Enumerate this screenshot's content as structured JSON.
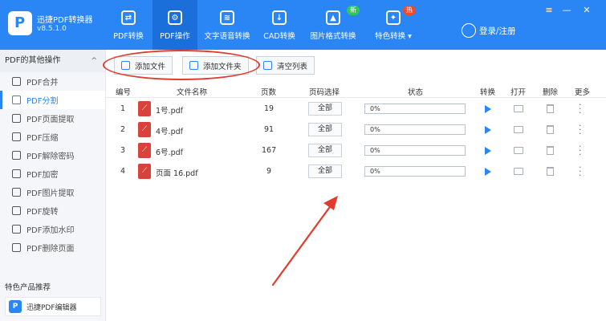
{
  "app": {
    "name": "迅捷PDF转换器",
    "version": "v8.5.1.0",
    "logo_letter": "P"
  },
  "nav": [
    {
      "label": "PDF转换",
      "icon": "refresh-icon",
      "glyph": "⇄"
    },
    {
      "label": "PDF操作",
      "icon": "gear-icon",
      "glyph": "⚙",
      "active": true
    },
    {
      "label": "文字语音转换",
      "icon": "audio-wave-icon",
      "glyph": "≋"
    },
    {
      "label": "CAD转换",
      "icon": "download-icon",
      "glyph": "↓"
    },
    {
      "label": "图片格式转换",
      "icon": "image-icon",
      "glyph": "▲",
      "badge": "新"
    },
    {
      "label": "特色转换 ▾",
      "icon": "star-gear-icon",
      "glyph": "✦",
      "badge": "热"
    }
  ],
  "login": {
    "label": "登录/注册"
  },
  "window_controls": {
    "menu": "≡",
    "minimize": "—",
    "close": "✕"
  },
  "sidebar": {
    "header": "PDF的其他操作",
    "chevron": "^",
    "items": [
      {
        "label": "PDF合并",
        "icon": "merge-icon"
      },
      {
        "label": "PDF分割",
        "icon": "split-icon",
        "active": true
      },
      {
        "label": "PDF页面提取",
        "icon": "page-extract-icon"
      },
      {
        "label": "PDF压缩",
        "icon": "compress-icon"
      },
      {
        "label": "PDF解除密码",
        "icon": "unlock-icon"
      },
      {
        "label": "PDF加密",
        "icon": "shield-icon"
      },
      {
        "label": "PDF图片提取",
        "icon": "image-extract-icon"
      },
      {
        "label": "PDF旋转",
        "icon": "rotate-icon"
      },
      {
        "label": "PDF添加水印",
        "icon": "watermark-icon"
      },
      {
        "label": "PDF删除页面",
        "icon": "delete-page-icon"
      }
    ],
    "section_title": "特色产品推荐",
    "promo": {
      "label": "迅捷PDF编辑器",
      "logo": "P"
    }
  },
  "toolbar": {
    "add_file": "添加文件",
    "add_folder": "添加文件夹",
    "clear_list": "清空列表"
  },
  "table": {
    "headers": [
      "编号",
      "文件名称",
      "页数",
      "页码选择",
      "状态",
      "转换",
      "打开",
      "删除",
      "更多"
    ],
    "page_select_label": "全部",
    "rows": [
      {
        "index": "1",
        "name": "1号.pdf",
        "pages": "19",
        "progress": "0%"
      },
      {
        "index": "2",
        "name": "4号.pdf",
        "pages": "91",
        "progress": "0%"
      },
      {
        "index": "3",
        "name": "6号.pdf",
        "pages": "167",
        "progress": "0%"
      },
      {
        "index": "4",
        "name": "页面 16.pdf",
        "pages": "9",
        "progress": "0%"
      }
    ]
  },
  "colors": {
    "primary": "#2b86f5",
    "annotation": "#e23a2e",
    "pdf_icon": "#d9423a"
  }
}
